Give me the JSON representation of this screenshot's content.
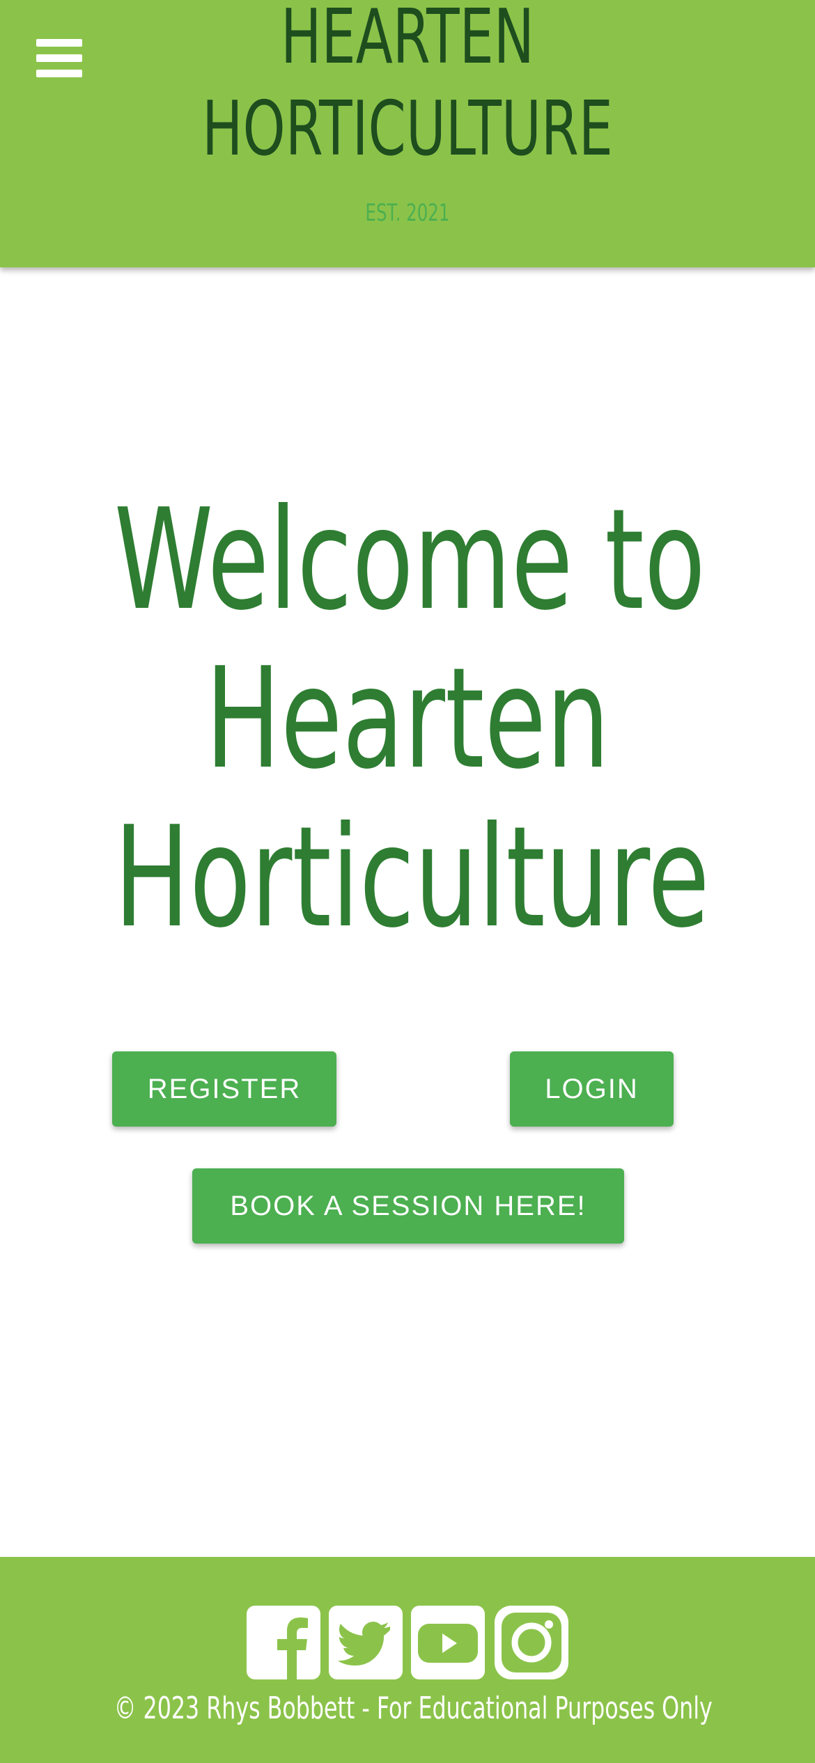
{
  "header": {
    "brand_line_1": "HEARTEN",
    "brand_line_2": "HORTICULTURE",
    "established": "EST. 2021",
    "menu_icon": "hamburger-menu-icon"
  },
  "hero": {
    "line_1": "Welcome to",
    "line_2": "Hearten",
    "line_3": "Horticulture"
  },
  "actions": {
    "register_label": "REGISTER",
    "login_label": "LOGIN",
    "book_label": "BOOK A SESSION HERE!"
  },
  "footer": {
    "socials": [
      "facebook-icon",
      "twitter-icon",
      "youtube-icon",
      "instagram-icon"
    ],
    "copyright": "© 2023 Rhys Bobbett - For Educational Purposes Only"
  },
  "colors": {
    "brand_green": "#8bc34a",
    "button_green": "#4caf50",
    "heading_green": "#2e7d32",
    "brand_dark": "#1e4d1e",
    "white": "#ffffff"
  }
}
